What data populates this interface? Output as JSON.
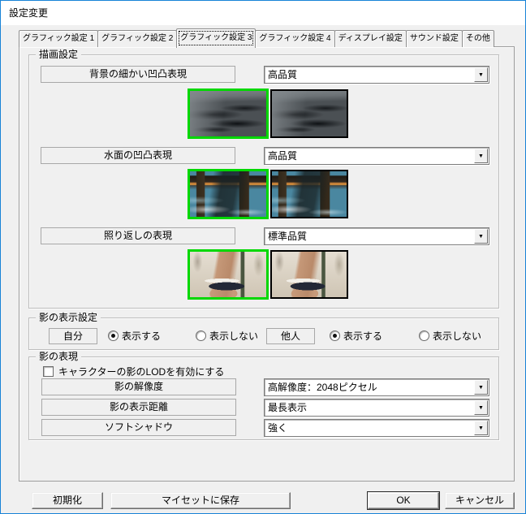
{
  "window": {
    "title": "設定変更"
  },
  "icons": {
    "dropdown_arrow": "▼"
  },
  "colors": {
    "accent_border": "#1883d7",
    "titlebar_bg": "#ffffff",
    "dialog_bg": "#f0f0f0",
    "selected_thumbnail_border": "#00d800",
    "unselected_thumbnail_border": "#000000"
  },
  "tabs": [
    {
      "label": "グラフィック設定 1",
      "selected": false
    },
    {
      "label": "グラフィック設定 2",
      "selected": false
    },
    {
      "label": "グラフィック設定 3",
      "selected": true
    },
    {
      "label": "グラフィック設定 4",
      "selected": false
    },
    {
      "label": "ディスプレイ設定",
      "selected": false
    },
    {
      "label": "サウンド設定",
      "selected": false
    },
    {
      "label": "その他",
      "selected": false
    }
  ],
  "drawing_settings": {
    "group_label": "描画設定",
    "rows": [
      {
        "label": "背景の細かい凹凸表現",
        "value": "高品質"
      },
      {
        "label": "水面の凹凸表現",
        "value": "高品質"
      },
      {
        "label": "照り返しの表現",
        "value": "標準品質"
      }
    ]
  },
  "shadow_display": {
    "group_label": "影の表示設定",
    "groups": [
      {
        "target_label": "自分",
        "options": [
          {
            "label": "表示する",
            "selected": true
          },
          {
            "label": "表示しない",
            "selected": false
          }
        ]
      },
      {
        "target_label": "他人",
        "options": [
          {
            "label": "表示する",
            "selected": true
          },
          {
            "label": "表示しない",
            "selected": false
          }
        ]
      }
    ]
  },
  "shadow_expression": {
    "group_label": "影の表現",
    "lod_checkbox_label": "キャラクターの影のLODを有効にする",
    "lod_checked": false,
    "rows": [
      {
        "label": "影の解像度",
        "value": "高解像度：2048ピクセル"
      },
      {
        "label": "影の表示距離",
        "value": "最長表示"
      },
      {
        "label": "ソフトシャドウ",
        "value": "強く"
      }
    ]
  },
  "buttons": {
    "initialize": "初期化",
    "save_myset": "マイセットに保存",
    "ok": "OK",
    "cancel": "キャンセル"
  }
}
